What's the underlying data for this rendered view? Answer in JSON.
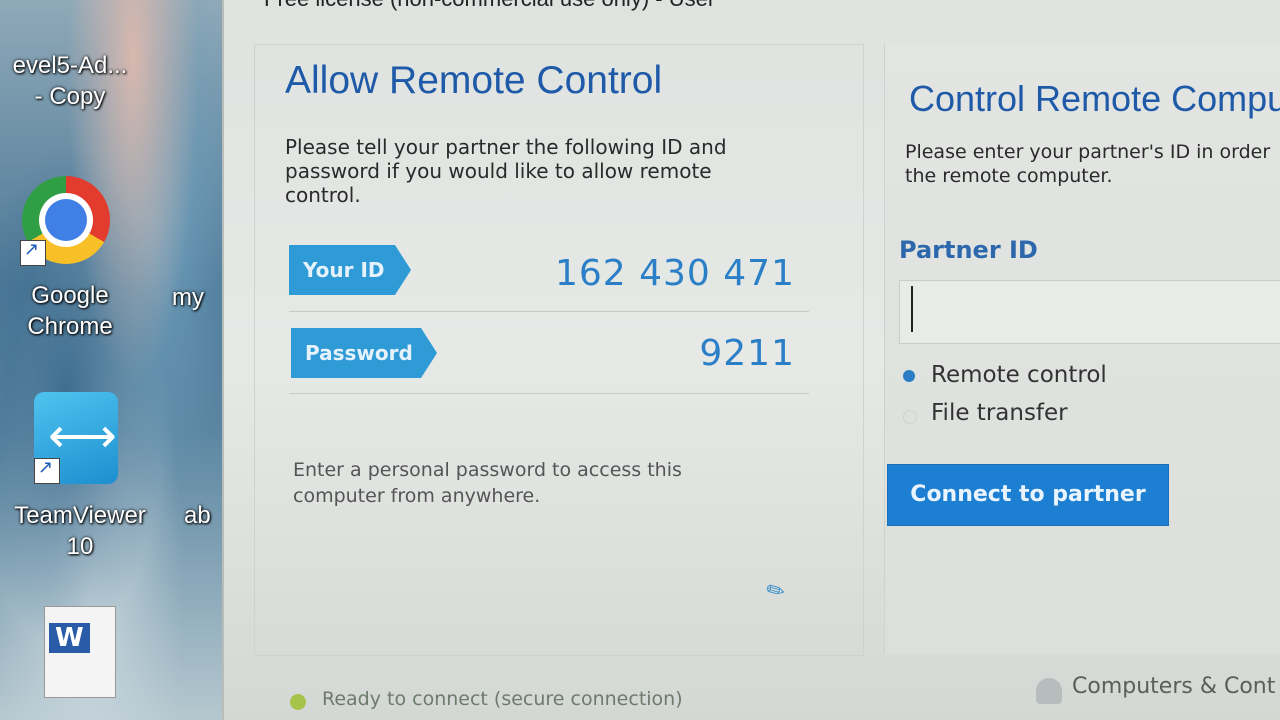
{
  "desktop": {
    "icons": [
      {
        "label": "evel5-Ad...\n- Copy"
      },
      {
        "label": "Google\nChrome"
      },
      {
        "label": "my"
      },
      {
        "label": "TeamViewer\n10"
      },
      {
        "label": "ab"
      }
    ]
  },
  "window": {
    "title": "Free license (non-commercial use only) - User"
  },
  "allow_remote": {
    "heading": "Allow Remote Control",
    "description": "Please tell your partner the following ID and password if you would like to allow remote control.",
    "id_label": "Your ID",
    "id_value": "162 430 471",
    "password_label": "Password",
    "password_value": "9211",
    "personal_password_note": "Enter a personal password to access this computer from anywhere."
  },
  "control_remote": {
    "heading": "Control Remote Compu",
    "description": "Please enter your partner's ID in order the remote computer.",
    "partner_id_label": "Partner ID",
    "partner_id_value": "",
    "options": [
      {
        "label": "Remote control",
        "selected": true
      },
      {
        "label": "File transfer",
        "selected": false
      }
    ],
    "connect_button": "Connect to partner"
  },
  "status": {
    "text": "Ready to connect (secure connection)",
    "color": "#a6c44a"
  },
  "footer": {
    "computers_contacts": "Computers & Cont"
  },
  "colors": {
    "accent": "#1e5aa8",
    "tag": "#2e9ad6",
    "button": "#1c7fd1"
  }
}
